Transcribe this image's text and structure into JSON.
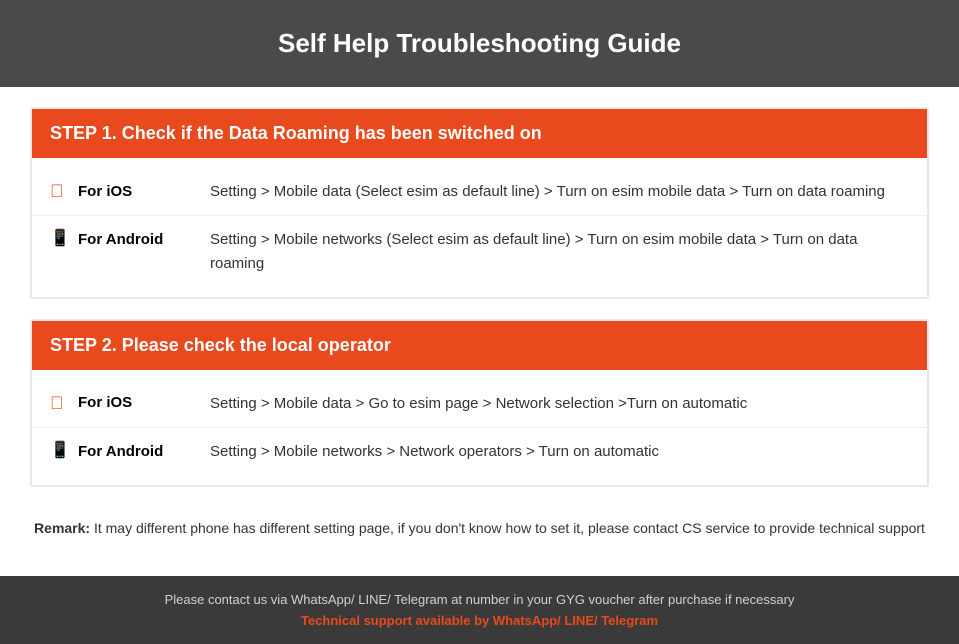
{
  "header": {
    "title": "Self Help Troubleshooting Guide"
  },
  "step1": {
    "heading": "STEP 1.  Check if the Data Roaming has been switched on",
    "ios_label": "For iOS",
    "ios_desc": "Setting > Mobile data (Select esim as default line) > Turn on esim mobile data > Turn on data roaming",
    "android_label": "For Android",
    "android_desc": "Setting > Mobile networks (Select esim as default line) > Turn on esim mobile data > Turn on data roaming"
  },
  "step2": {
    "heading": "STEP 2.  Please check the local operator",
    "ios_label": "For iOS",
    "ios_desc": "Setting > Mobile data > Go to esim page > Network selection >Turn on automatic",
    "android_label": "For Android",
    "android_desc": "Setting > Mobile networks > Network operators > Turn on automatic"
  },
  "remark": {
    "label": "Remark:",
    "text": " It may different phone has different setting page, if you don't know how to set it,  please contact CS service to provide technical support"
  },
  "footer": {
    "contact_line": "Please contact us via WhatsApp/ LINE/ Telegram at number in your GYG voucher after purchase if necessary",
    "support_line": "Technical support available by WhatsApp/ LINE/ Telegram"
  }
}
